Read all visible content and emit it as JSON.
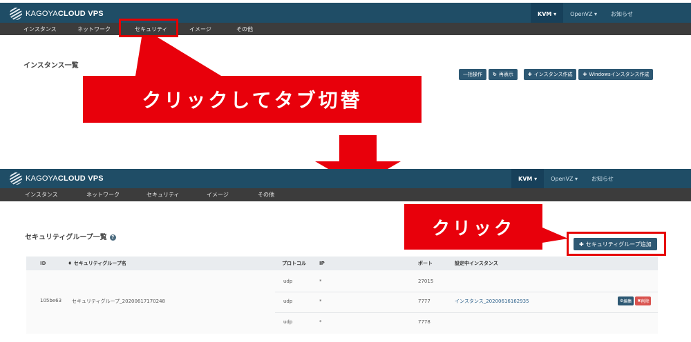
{
  "brand": {
    "prefix": "KAGOYA",
    "strong": "CLOUD VPS"
  },
  "top_nav": [
    {
      "label": "KVM ▾",
      "active": true
    },
    {
      "label": "OpenVZ ▾",
      "active": false
    },
    {
      "label": "お知らせ",
      "active": false
    }
  ],
  "sub_nav": [
    {
      "label": "インスタンス"
    },
    {
      "label": "ネットワーク"
    },
    {
      "label": "セキュリティ"
    },
    {
      "label": "イメージ"
    },
    {
      "label": "その他"
    }
  ],
  "screen1": {
    "title": "インスタンス一覧",
    "buttons": [
      {
        "icon": "",
        "label": "一括操作"
      },
      {
        "icon": "↻",
        "label": "再表示"
      },
      {
        "icon": "✚",
        "label": "インスタンス作成"
      },
      {
        "icon": "✚",
        "label": "Windowsインスタンス作成"
      }
    ]
  },
  "annotations": {
    "callout_tab": "クリックしてタブ切替",
    "callout_click": "クリック"
  },
  "screen2": {
    "title": "セキュリティグループ一覧",
    "help_icon": "?",
    "add_button": {
      "icon": "✚",
      "label": "セキュリティグループ追加"
    },
    "table": {
      "headers": {
        "id": "ID",
        "name": "セキュリティグループ名",
        "name_sort": "♦",
        "protocol": "プロトコル",
        "ip": "IP",
        "port": "ポート",
        "instance": "設定中インスタンス"
      },
      "row": {
        "id": "105be63",
        "name": "セキュリティグループ_20200617170248",
        "instance": "インスタンス_20200616162935",
        "rules": [
          {
            "protocol": "udp",
            "ip": "*",
            "port": "27015"
          },
          {
            "protocol": "udp",
            "ip": "*",
            "port": "7777"
          },
          {
            "protocol": "udp",
            "ip": "*",
            "port": "7778"
          }
        ],
        "edit_label": "編集",
        "edit_icon": "⚙",
        "delete_label": "削除",
        "delete_icon": "✖"
      }
    }
  },
  "colors": {
    "navbar": "#1f4d66",
    "subbar": "#3c3c3c",
    "button": "#2d5873",
    "annotation_red": "#e8000b"
  }
}
